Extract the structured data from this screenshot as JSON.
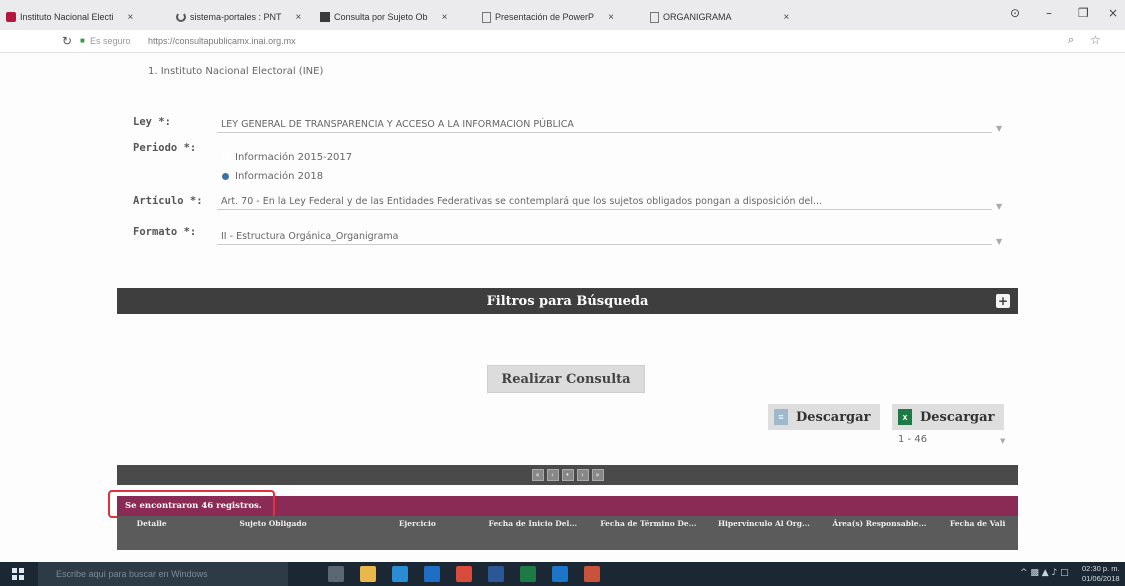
{
  "browser": {
    "tabs": [
      {
        "title": "Instituto Nacional Electi",
        "icon": "ine-logo-icon",
        "color": "#b3163e"
      },
      {
        "title": "sistema-portales : PNT",
        "icon": "loading-icon",
        "color": "#555555"
      },
      {
        "title": "Consulta por Sujeto Ob",
        "icon": "pnt-favicon-icon",
        "color": "#3a3a3a"
      },
      {
        "title": "Presentación de PowerP",
        "icon": "page-icon",
        "color": "#777777"
      },
      {
        "title": "ORGANIGRAMA",
        "icon": "page-icon",
        "color": "#777777"
      }
    ],
    "tab_close": "×",
    "window_controls": {
      "account": "⊙",
      "minimize": "–",
      "maximize": "❒",
      "close": "×"
    },
    "address": {
      "security": "Es seguro",
      "url": "https://consultapublicamx.inai.org.mx"
    }
  },
  "page": {
    "institution": "1. Instituto Nacional Electoral (INE)",
    "ley": {
      "label": "Ley *:",
      "value": "LEY GENERAL DE TRANSPARENCIA Y ACCESO A LA INFORMACION PÚBLICA"
    },
    "periodo": {
      "label": "Periodo *:",
      "options": [
        {
          "label": "Información 2015-2017",
          "selected": false
        },
        {
          "label": "Información 2018",
          "selected": true
        }
      ]
    },
    "articulo": {
      "label": "Artículo *:",
      "value": "Art. 70 - En la Ley Federal y de las Entidades Federativas se contemplará que los sujetos obligados pongan a disposición del..."
    },
    "formato": {
      "label": "Formato *:",
      "value": "II - Estructura Orgánica_Organigrama"
    },
    "filters_title": "Filtros para Búsqueda",
    "filters_toggle": "+",
    "consulta_button": "Realizar Consulta",
    "download_buttons": [
      "Descargar",
      "Descargar"
    ],
    "pager_range": "1 - 46",
    "records_found": "Se encontraron 46 registros.",
    "table_headers": [
      "Detalle",
      "Sujeto Obligado",
      "Ejercicio",
      "Fecha de Inicio Del...",
      "Fecha de Término De...",
      "Hipervínculo Al Org...",
      "Área(s) Responsable...",
      "Fecha de Vali"
    ]
  },
  "taskbar": {
    "search_placeholder": "Escribe aquí para buscar en Windows",
    "apps": [
      "task-view",
      "file-explorer",
      "skype",
      "outlook",
      "chrome",
      "word",
      "excel",
      "edge",
      "powerpoint"
    ],
    "app_colors": [
      "#5a6874",
      "#e8b84a",
      "#2b8cd6",
      "#1e6fc4",
      "#d94b3a",
      "#2b5797",
      "#1d7a45",
      "#1b76c9",
      "#c9533a"
    ],
    "time": "02:30 p. m.",
    "date": "01/06/2018"
  },
  "colors": {
    "records_bar": "#8a2b55",
    "filters_bar": "#3e3e3e",
    "highlight": "#e0323c"
  }
}
